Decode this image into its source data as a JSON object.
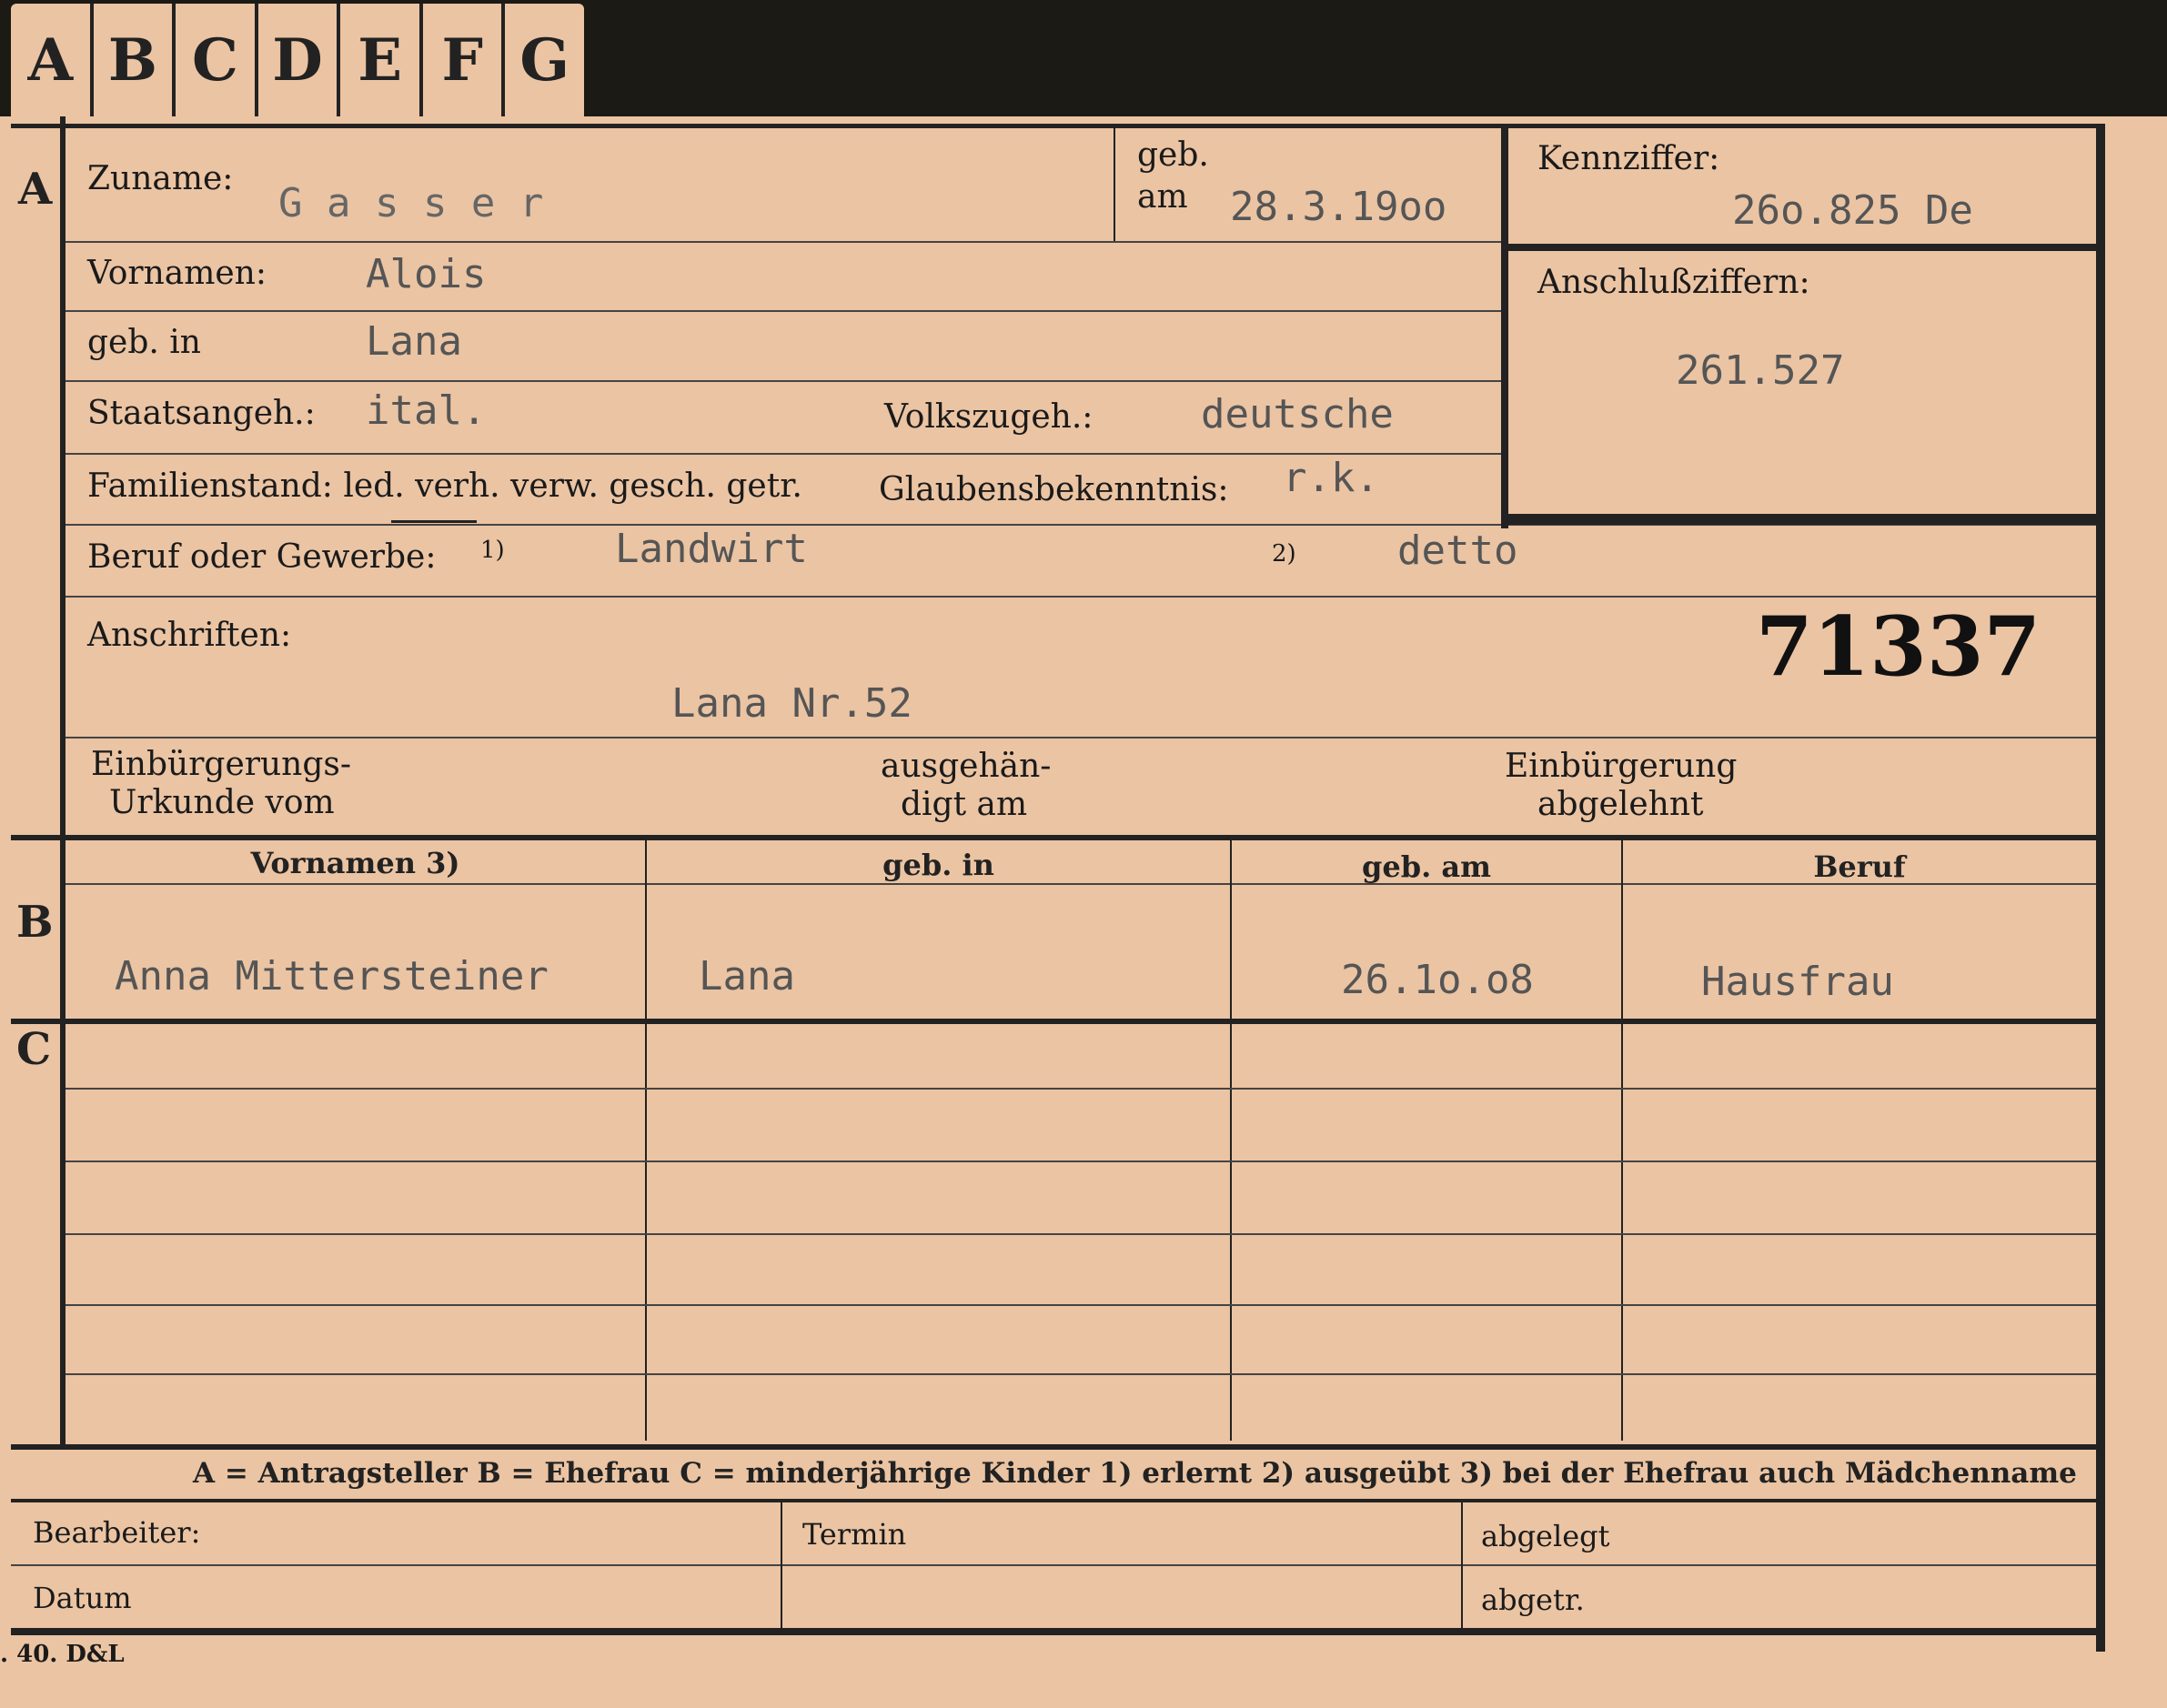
{
  "tabs": [
    "A",
    "B",
    "C",
    "D",
    "E",
    "F",
    "G"
  ],
  "sections": {
    "a": "A",
    "b": "B",
    "c": "C"
  },
  "labels": {
    "zuname": "Zuname:",
    "geb": "geb.",
    "am": "am",
    "vornamen": "Vornamen:",
    "geb_in": "geb. in",
    "staatsangeh": "Staatsangeh.:",
    "volkszugeh": "Volkszugeh.:",
    "familienstand": "Familienstand: led. verh. verw. gesch. getr.",
    "glaubensbekenntnis": "Glaubensbekenntnis:",
    "beruf": "Beruf oder Gewerbe:",
    "fn1": "1)",
    "fn2": "2)",
    "anschriften": "Anschriften:",
    "einbuergerung_urkunde_1": "Einbürgerungs-",
    "einbuergerung_urkunde_2": "Urkunde vom",
    "ausgehaendigt_1": "ausgehän-",
    "ausgehaendigt_2": "digt am",
    "einbuergerung_abgelehnt_1": "Einbürgerung",
    "einbuergerung_abgelehnt_2": "abgelehnt",
    "kennziffer": "Kennziffer:",
    "anschlussziffern": "Anschlußziffern:"
  },
  "values": {
    "zuname": "G a s s e r",
    "geb_am": "28.3.19oo",
    "vornamen": "Alois",
    "geb_in": "Lana",
    "staatsangeh": "ital.",
    "volkszugeh": "deutsche",
    "glaubensbekenntnis": "r.k.",
    "beruf_erlernt": "Landwirt",
    "beruf_ausgeuebt": "detto",
    "anschrift": "Lana Nr.52",
    "stamp_number": "71337",
    "kennziffer": "26o.825 De",
    "anschlussziffer": "261.527"
  },
  "table": {
    "headers": [
      "Vornamen 3)",
      "geb. in",
      "geb. am",
      "Beruf"
    ],
    "b_row": [
      "Anna Mittersteiner",
      "Lana",
      "26.1o.o8",
      "Hausfrau"
    ]
  },
  "footer": {
    "legend": "A = Antragsteller   B = Ehefrau   C = minderjährige Kinder   1) erlernt   2) ausgeübt   3) bei der Ehefrau auch Mädchenname",
    "bearbeiter": "Bearbeiter:",
    "termin": "Termin",
    "abgelegt": "abgelegt",
    "datum": "Datum",
    "abgetr": "abgetr.",
    "print_code": ". 40. D&L"
  }
}
